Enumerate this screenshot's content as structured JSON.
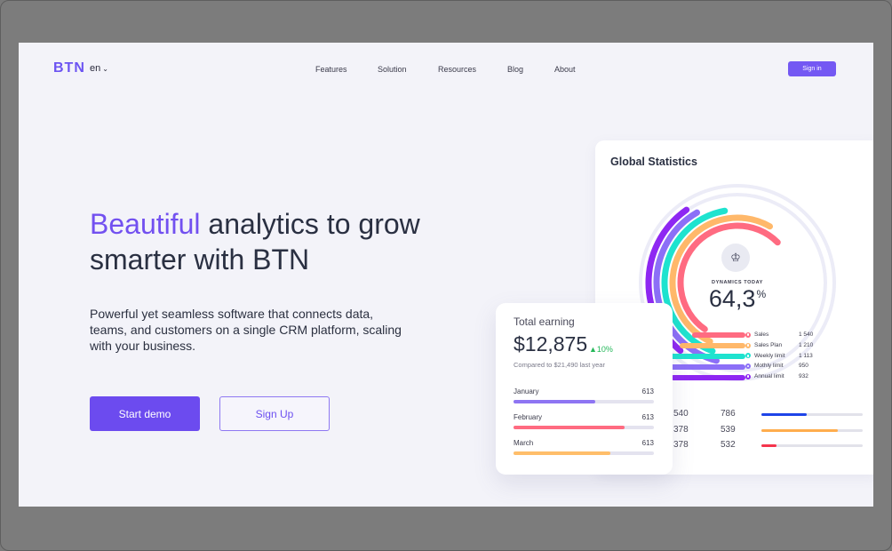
{
  "nav": {
    "logo": "BTN",
    "language": "en",
    "links": [
      "Features",
      "Solution",
      "Resources",
      "Blog",
      "About"
    ],
    "signin": "Sign in"
  },
  "hero": {
    "headline_accent": "Beautiful",
    "headline_rest": " analytics to grow smarter with BTN",
    "subtitle": "Powerful yet seamless software that connects data, teams, and customers on a single CRM platform, scaling with your business.",
    "primary_button": "Start demo",
    "secondary_button": "Sign Up"
  },
  "stats": {
    "title": "Global Statistics",
    "dynamics_label": "DYNAMICS TODAY",
    "dynamics_value": "64,3",
    "dynamics_unit": "%",
    "legend": [
      {
        "name": "Sales",
        "value": "1 540",
        "color": "#ff6b81"
      },
      {
        "name": "Sales Plan",
        "value": "1 210",
        "color": "#ffb86a"
      },
      {
        "name": "Weekly limit",
        "value": "1 113",
        "color": "#1ee3cf"
      },
      {
        "name": "Mothly limit",
        "value": "950",
        "color": "#8c6ff7"
      },
      {
        "name": "Annual limit",
        "value": "932",
        "color": "#8e27f2"
      }
    ],
    "rows": [
      {
        "a": "540",
        "b": "786",
        "fill": 0.45,
        "color": "#1e44e8"
      },
      {
        "a": "378",
        "b": "539",
        "fill": 0.75,
        "color": "#ffad4d"
      },
      {
        "a": "378",
        "b": "532",
        "fill": 0.15,
        "color": "#f5344c"
      }
    ]
  },
  "earnings": {
    "title": "Total earning",
    "value": "$12,875",
    "change": "10%",
    "compare": "Compared to $21,490 last year",
    "months": [
      {
        "name": "January",
        "value": "613",
        "fill": 0.58,
        "color": "#8e75f3"
      },
      {
        "name": "February",
        "value": "613",
        "fill": 0.79,
        "color": "#ff6b81"
      },
      {
        "name": "March",
        "value": "613",
        "fill": 0.69,
        "color": "#ffbe6a"
      }
    ]
  }
}
